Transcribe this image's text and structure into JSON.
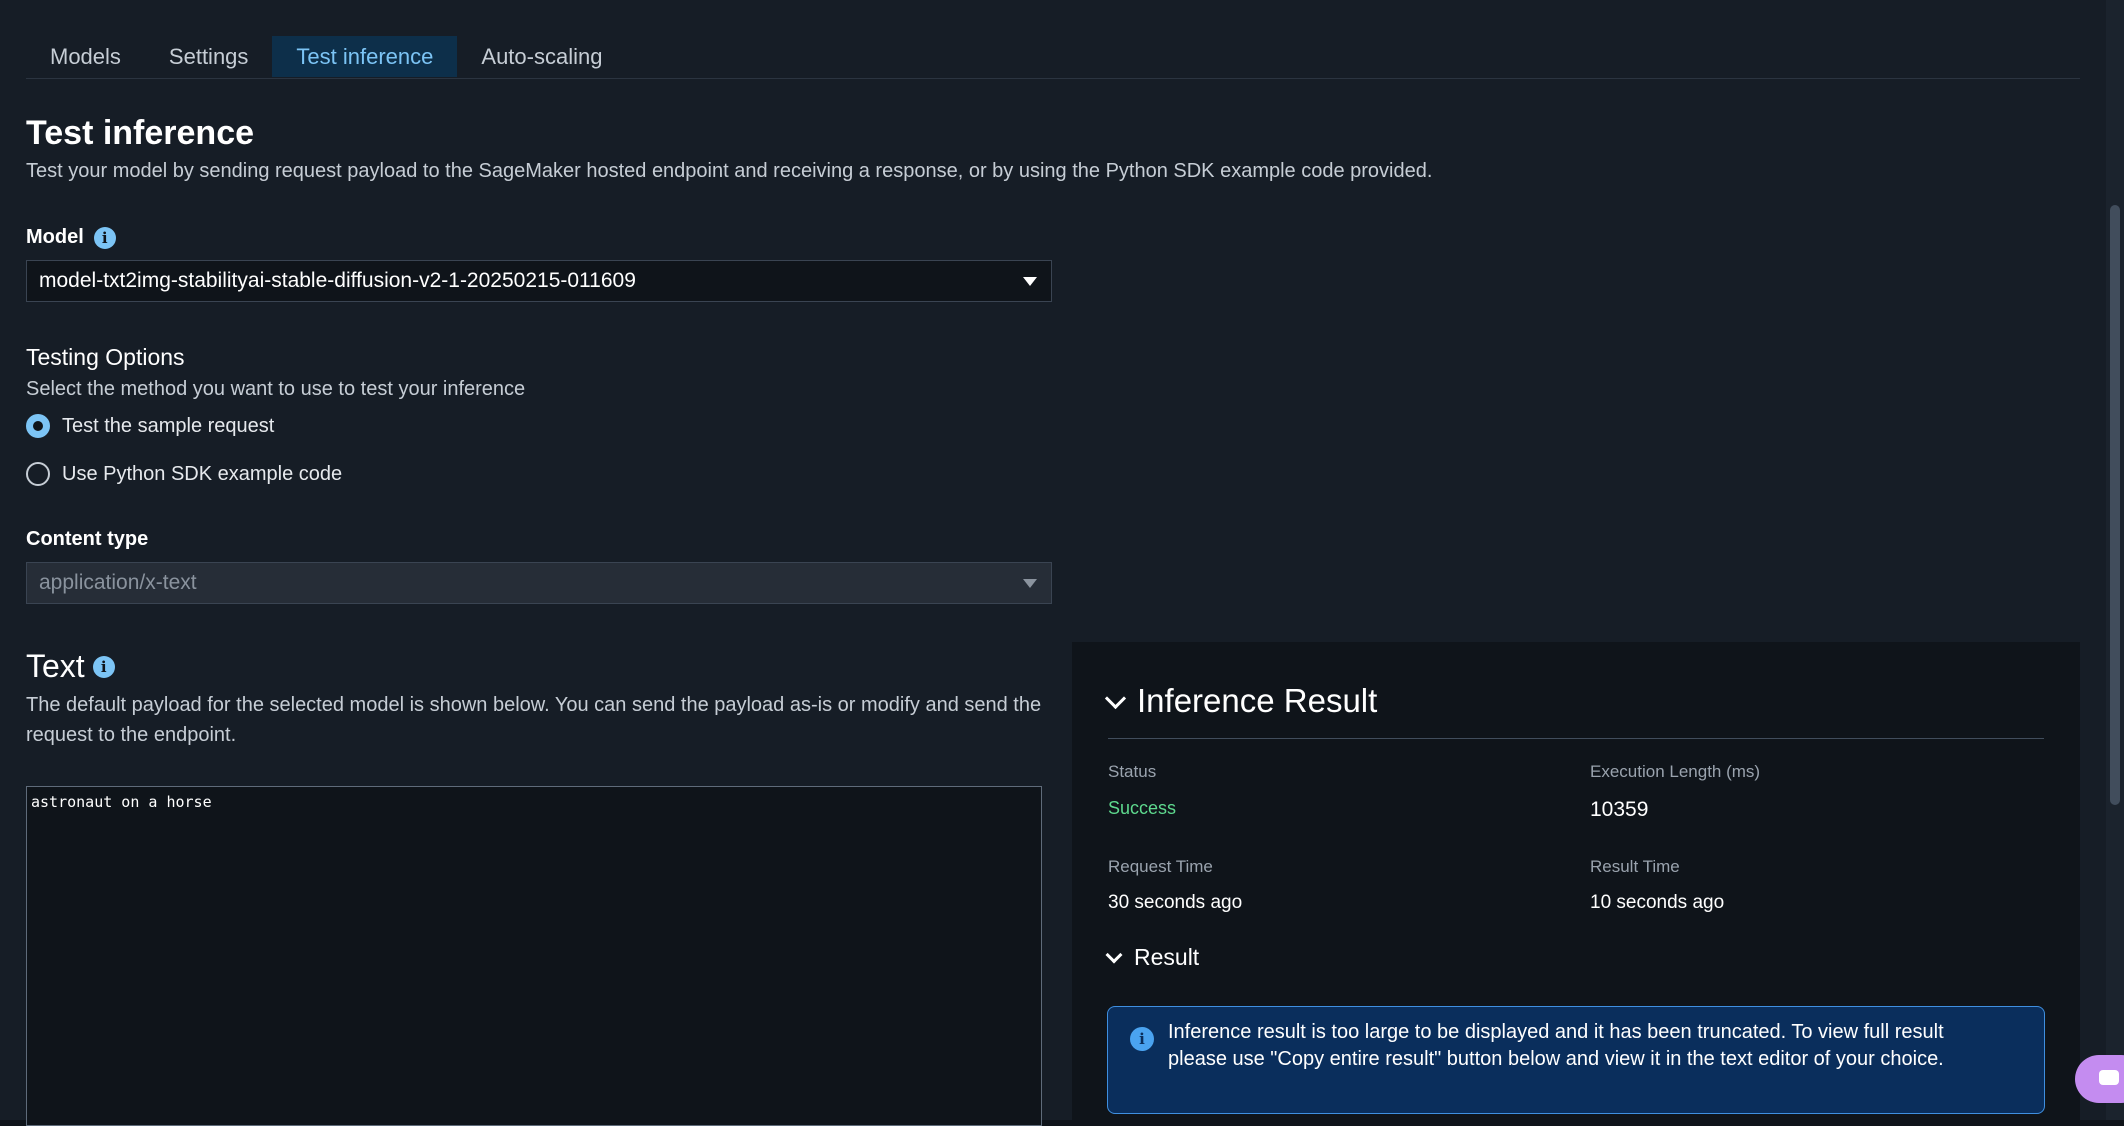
{
  "tabs": [
    {
      "label": "Models"
    },
    {
      "label": "Settings"
    },
    {
      "label": "Test inference"
    },
    {
      "label": "Auto-scaling"
    }
  ],
  "page": {
    "title": "Test inference",
    "description": "Test your model by sending request payload to the SageMaker hosted endpoint and receiving a response, or by using the Python SDK example code provided."
  },
  "model": {
    "label": "Model",
    "selected": "model-txt2img-stabilityai-stable-diffusion-v2-1-20250215-011609"
  },
  "testing": {
    "title": "Testing Options",
    "description": "Select the method you want to use to test your inference",
    "options": [
      {
        "label": "Test the sample request",
        "checked": true
      },
      {
        "label": "Use Python SDK example code",
        "checked": false
      }
    ]
  },
  "content_type": {
    "label": "Content type",
    "selected": "application/x-text"
  },
  "text": {
    "title": "Text",
    "description": "The default payload for the selected model is shown below. You can send the payload as-is or modify and send the request to the endpoint.",
    "value": "astronaut on a horse"
  },
  "inference_result": {
    "title": "Inference Result",
    "status_label": "Status",
    "status_value": "Success",
    "exec_label": "Execution Length (ms)",
    "exec_value": "10359",
    "request_time_label": "Request Time",
    "request_time_value": "30 seconds ago",
    "result_time_label": "Result Time",
    "result_time_value": "10 seconds ago",
    "result_title": "Result",
    "alert_text": "Inference result is too large to be displayed and it has been truncated. To view full result please use \"Copy entire result\" button below and view it in the text editor of your choice."
  },
  "icons": {
    "info": "info-icon",
    "caret": "caret-down-icon",
    "chevron": "chevron-down-icon",
    "chat": "chat-icon"
  },
  "colors": {
    "accent": "#7cc4f5",
    "success": "#5ed98e",
    "alert_bg": "#0a2e5c",
    "chat": "#c48cf0"
  }
}
